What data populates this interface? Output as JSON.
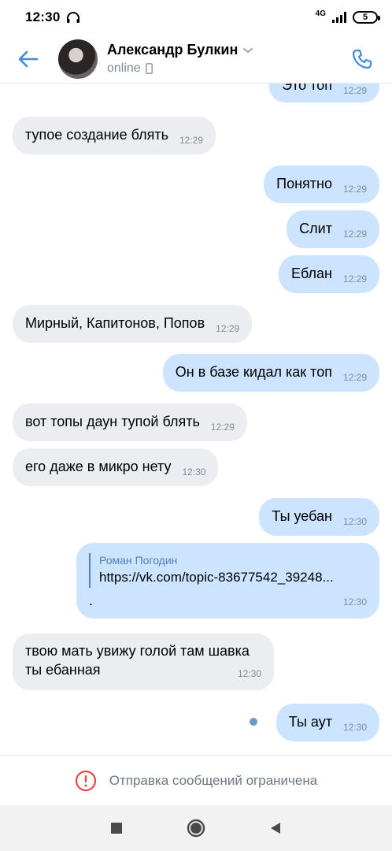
{
  "status_bar": {
    "time": "12:30",
    "network": "4G",
    "battery": "5"
  },
  "header": {
    "contact_name": "Александр Булкин",
    "status": "online",
    "accent": "#3f8ae0"
  },
  "messages": [
    {
      "dir": "out",
      "text": "Это топ",
      "time": "12:29"
    },
    {
      "dir": "in",
      "text": "тупое создание блять",
      "time": "12:29"
    },
    {
      "dir": "out",
      "text": "Понятно",
      "time": "12:29"
    },
    {
      "dir": "out",
      "text": "Слит",
      "time": "12:29"
    },
    {
      "dir": "out",
      "text": "Еблан",
      "time": "12:29"
    },
    {
      "dir": "in",
      "text": "Мирный, Капитонов, Попов",
      "time": "12:29"
    },
    {
      "dir": "out",
      "text": "Он в базе кидал как топ",
      "time": "12:29"
    },
    {
      "dir": "in",
      "text": "вот топы даун тупой блять",
      "time": "12:29"
    },
    {
      "dir": "in",
      "text": "его даже в микро нету",
      "time": "12:30"
    },
    {
      "dir": "out",
      "text": "Ты уебан",
      "time": "12:30"
    },
    {
      "dir": "out",
      "reply_author": "Роман Погодин",
      "reply_text": "https://vk.com/topic-83677542_39248...",
      "text": ".",
      "time": "12:30"
    },
    {
      "dir": "in",
      "text_line1": "твою мать увижу голой там шавка",
      "text_line2": "ты ебанная",
      "time": "12:30"
    },
    {
      "dir": "out",
      "text": "Ты аут",
      "time": "12:30",
      "unread": true
    }
  ],
  "footer": {
    "notice": "Отправка сообщений ограничена"
  },
  "colors": {
    "incoming_bubble": "#ebedf0",
    "outgoing_bubble": "#cce4ff",
    "time_text": "#818c99",
    "warning": "#e64646"
  },
  "icons": [
    "headphones-icon",
    "back-arrow-icon",
    "chevron-down-icon",
    "mobile-icon",
    "phone-icon",
    "warning-icon",
    "nav-recents-icon",
    "nav-home-icon",
    "nav-back-icon"
  ]
}
